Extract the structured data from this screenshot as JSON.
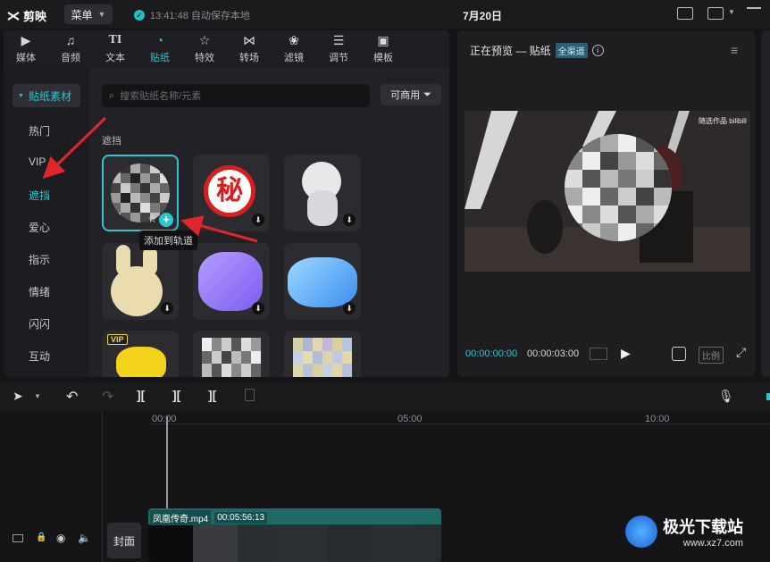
{
  "topbar": {
    "app_name": "剪映",
    "menu_label": "菜单",
    "save_status": "13:41:48 自动保存本地",
    "date_title": "7月20日"
  },
  "tools": [
    {
      "label": "媒体",
      "icon": "media-icon"
    },
    {
      "label": "音频",
      "icon": "audio-icon"
    },
    {
      "label": "文本",
      "icon": "text-icon"
    },
    {
      "label": "贴纸",
      "icon": "sticker-icon",
      "active": true
    },
    {
      "label": "特效",
      "icon": "effects-icon"
    },
    {
      "label": "转场",
      "icon": "transition-icon"
    },
    {
      "label": "滤镜",
      "icon": "filter-icon"
    },
    {
      "label": "调节",
      "icon": "adjust-icon"
    },
    {
      "label": "模板",
      "icon": "template-icon"
    }
  ],
  "sidebar": {
    "header": "贴纸素材",
    "items": [
      "热门",
      "VIP",
      "遮挡",
      "爱心",
      "指示",
      "情绪",
      "闪闪",
      "互动"
    ],
    "selected": "遮挡"
  },
  "search": {
    "placeholder": "搜索贴纸名称/元素"
  },
  "filter_label": "可商用",
  "section_title": "遮挡",
  "sticker_tiles": [
    {
      "name": "mosaic-circle-sticker",
      "selected": true
    },
    {
      "name": "secret-stamp-sticker",
      "text": "秘"
    },
    {
      "name": "white-dog-sticker"
    },
    {
      "name": "bunny-sticker"
    },
    {
      "name": "purple-cat-sticker"
    },
    {
      "name": "blue-cat-sticker"
    },
    {
      "name": "yellow-chick-sticker",
      "badge": "VIP"
    },
    {
      "name": "mosaic-square-sticker"
    },
    {
      "name": "color-mosaic-sticker"
    }
  ],
  "tooltip": "添加到轨道",
  "preview": {
    "title": "正在预览 — 贴纸",
    "badge": "全渠道",
    "current_time": "00:00:00:00",
    "total_time": "00:00:03:00",
    "ratio_label": "比例",
    "overlay_text": "随选作品 bilibili"
  },
  "timeline": {
    "ruler": [
      "00:00",
      "05:00",
      "10:00"
    ],
    "clip_name": "凤凰传奇.mp4",
    "clip_duration": "00:05:56:13",
    "cover_label": "封面"
  },
  "watermark": {
    "site": "极光下载站",
    "url": "www.xz7.com"
  },
  "colors": {
    "accent": "#2ec5d3",
    "annotation_arrow": "#e0262d",
    "clip": "#1d6a66"
  }
}
